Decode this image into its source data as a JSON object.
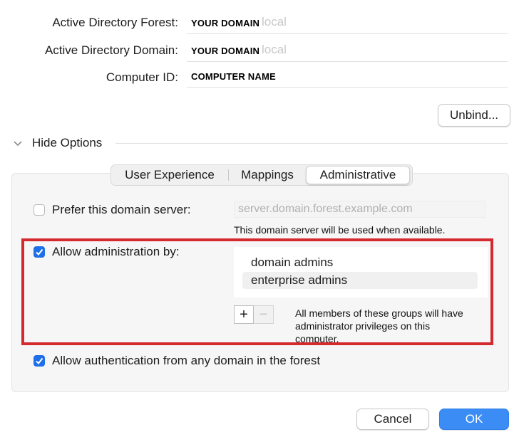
{
  "fields": {
    "forest": {
      "label": "Active Directory Forest:",
      "value": "YOUR DOMAIN",
      "ghost": "local"
    },
    "domain": {
      "label": "Active Directory Domain:",
      "value": "YOUR DOMAIN",
      "ghost": "local"
    },
    "computer": {
      "label": "Computer ID:",
      "value": "COMPUTER NAME"
    }
  },
  "unbind_label": "Unbind...",
  "options": {
    "toggle_label": "Hide Options"
  },
  "tabs": [
    {
      "label": "User Experience",
      "selected": false
    },
    {
      "label": "Mappings",
      "selected": false
    },
    {
      "label": "Administrative",
      "selected": true
    }
  ],
  "prefer_server": {
    "label": "Prefer this domain server:",
    "checked": false,
    "placeholder": "server.domain.forest.example.com",
    "note": "This domain server will be used when available."
  },
  "allow_admin": {
    "label": "Allow administration by:",
    "checked": true,
    "groups": [
      "domain admins",
      "enterprise admins"
    ],
    "selected_index": 1,
    "add_label": "+",
    "remove_label": "−",
    "note_line1": "All members of these groups will have",
    "note_line2": "administrator privileges on this",
    "note_line3": "computer."
  },
  "allow_auth": {
    "label": "Allow authentication from any domain in the forest",
    "checked": true
  },
  "buttons": {
    "cancel": "Cancel",
    "ok": "OK"
  },
  "colors": {
    "accent": "#1e6fe8",
    "highlight": "#d42a2e"
  }
}
